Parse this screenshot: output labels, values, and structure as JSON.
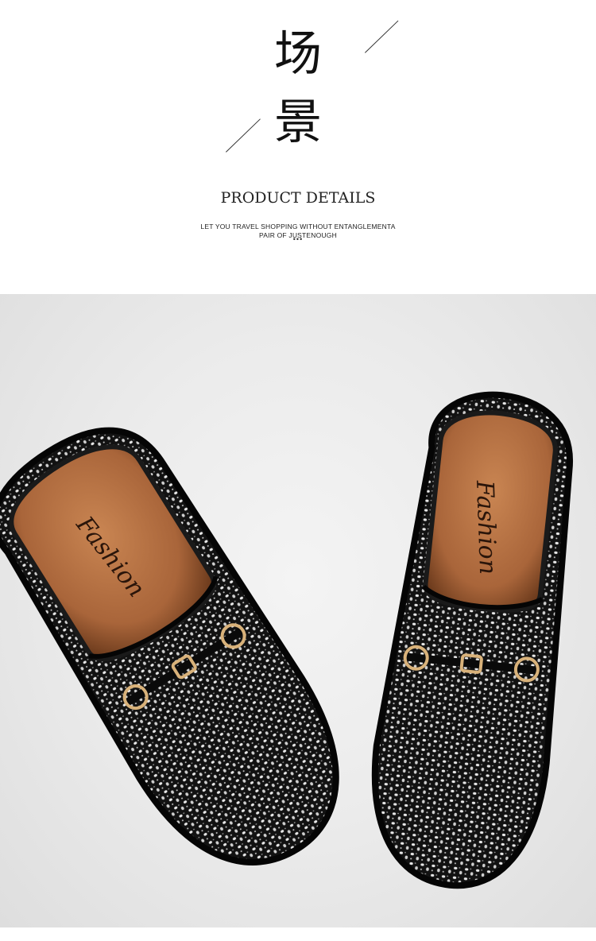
{
  "header": {
    "title_cn_1": "场",
    "title_cn_2": "景",
    "title_en": "PRODUCT DETAILS",
    "subtitle_line1": "LET YOU TRAVEL SHOPPING WITHOUT ENTANGLEMENTA",
    "subtitle_line2": "PAIR OF JUSTENOUGH",
    "dots": "•••"
  },
  "photo": {
    "insole_text_left": "Fashion",
    "insole_text_right": "Fashion",
    "colors": {
      "background": "#e9e9e9",
      "shoe_body": "#111111",
      "insole": "#b06a3c",
      "buckle": "#d9b27a"
    }
  }
}
